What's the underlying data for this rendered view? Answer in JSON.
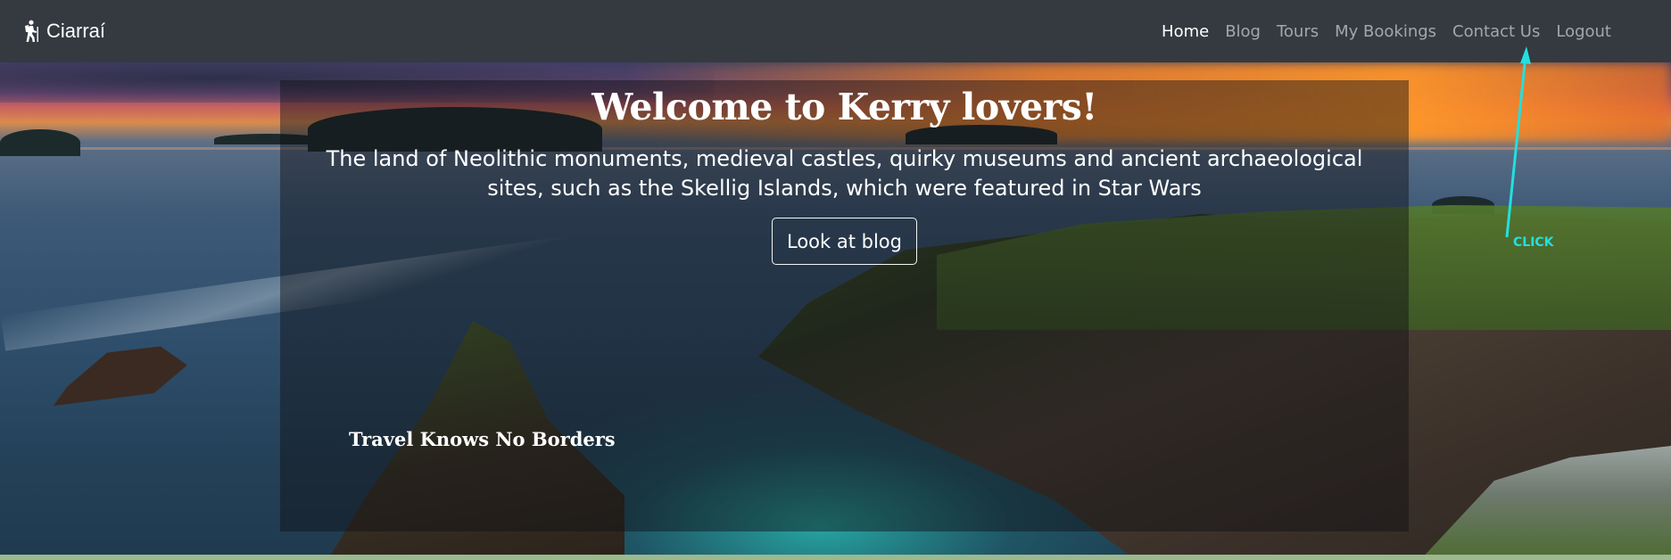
{
  "navbar": {
    "brand_icon": "hiker-icon",
    "brand_text": "Ciarraí",
    "links": [
      {
        "label": "Home",
        "active": true
      },
      {
        "label": "Blog",
        "active": false
      },
      {
        "label": "Tours",
        "active": false
      },
      {
        "label": "My Bookings",
        "active": false
      },
      {
        "label": "Contact Us",
        "active": false
      },
      {
        "label": "Logout",
        "active": false
      }
    ]
  },
  "hero": {
    "title": "Welcome to Kerry lovers!",
    "subtitle": "The land of Neolithic monuments, medieval castles, quirky museums and ancient archaeological sites, such as the Skellig Islands, which were featured in Star Wars",
    "button_label": "Look at blog",
    "tagline": "Travel Knows No Borders"
  },
  "annotation": {
    "label": "CLICK",
    "color": "#22e0e0"
  },
  "colors": {
    "navbar_bg": "#343a40",
    "nav_active": "#ffffff",
    "nav_inactive": "rgba(255,255,255,0.55)"
  }
}
